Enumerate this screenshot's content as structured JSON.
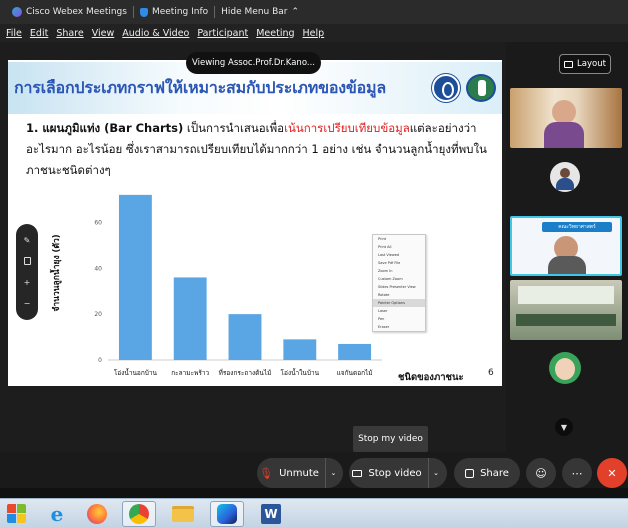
{
  "window": {
    "app_title": "Cisco Webex Meetings",
    "meeting_info": "Meeting Info",
    "hide_menu": "Hide Menu Bar",
    "hide_menu_arrow": "⌃"
  },
  "menu": [
    "File",
    "Edit",
    "Share",
    "View",
    "Audio & Video",
    "Participant",
    "Meeting",
    "Help"
  ],
  "share": {
    "viewing_label": "Viewing Assoc.Prof.Dr.Kano..."
  },
  "slide": {
    "title": "การเลือกประเภทกราฟให้เหมาะสมกับประเภทของข้อมูล",
    "para_lead": "1. แผนภูมิแท่ง (Bar Charts)",
    "para_a": " เป็นการนำเสนอเพื่อ",
    "para_highlight": "เน้นการเปรียบเทียบข้อมูล",
    "para_b": "แต่ละอย่างว่าอะไรมาก อะไรน้อย ซึ่งเราสามารถเปรียบเทียบได้มากกว่า 1 อย่าง เช่น จำนวนลูกน้ำยุงที่พบในภาชนะชนิดต่างๆ",
    "page_number": "6",
    "context_menu": [
      "Print",
      "Print All",
      "Last Viewed",
      "Save Pdf File",
      "Zoom In",
      "Custom Zoom",
      "Slides Presenter View",
      "Rotate",
      "Pointer Options",
      "Laser",
      "Pen",
      "Eraser",
      "End Show"
    ],
    "context_menu_selected": 8
  },
  "chart_data": {
    "type": "bar",
    "categories": [
      "โอ่งน้ำนอกบ้าน",
      "กะลามะพร้าว",
      "ที่รองกระถางต้นไม้",
      "โอ่งน้ำในบ้าน",
      "แจกันดอกไม้"
    ],
    "values": [
      72,
      36,
      20,
      9,
      7
    ],
    "xlabel": "ชนิดของภาชนะ",
    "ylabel": "จำนวนลูกน้ำยุง (ตัว)",
    "yticks": [
      0,
      20,
      40,
      60
    ],
    "ylim": [
      0,
      75
    ],
    "bar_color": "#5aa5e3"
  },
  "side_tools": [
    "✎",
    "🖫",
    "+",
    "−"
  ],
  "layout_button": "Layout",
  "participants": {
    "thumb_title": "คณะวิทยาศาสตร์"
  },
  "tooltip": "Stop my video",
  "controls": {
    "mute": "Unmute",
    "video": "Stop video",
    "share": "Share",
    "more": "⋯",
    "end": "✕"
  },
  "colors": {
    "accent_red": "#e2402a",
    "title_blue": "#2b56b5",
    "highlight_red": "#e02020"
  }
}
